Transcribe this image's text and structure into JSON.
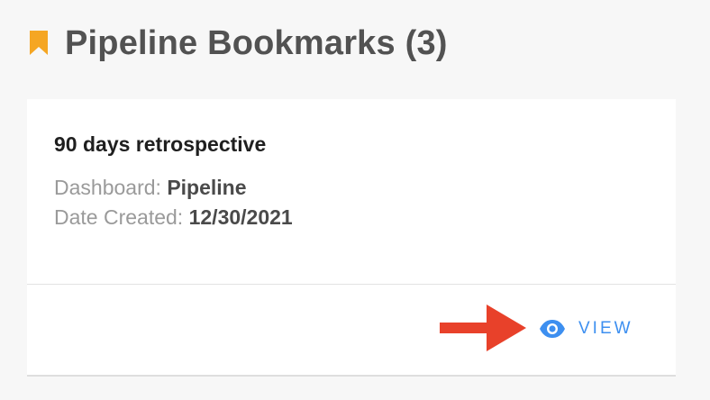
{
  "header": {
    "icon": "bookmark-icon",
    "title": "Pipeline Bookmarks (3)",
    "accent_color": "#f5a623"
  },
  "bookmark": {
    "title": "90 days retrospective",
    "dashboard_label": "Dashboard:",
    "dashboard_value": "Pipeline",
    "date_label": "Date Created:",
    "date_value": "12/30/2021",
    "view_icon": "eye-icon",
    "view_label": "VIEW",
    "link_color": "#3d8ff0"
  },
  "annotation": {
    "icon": "arrow-right-icon",
    "color": "#e8412a"
  }
}
